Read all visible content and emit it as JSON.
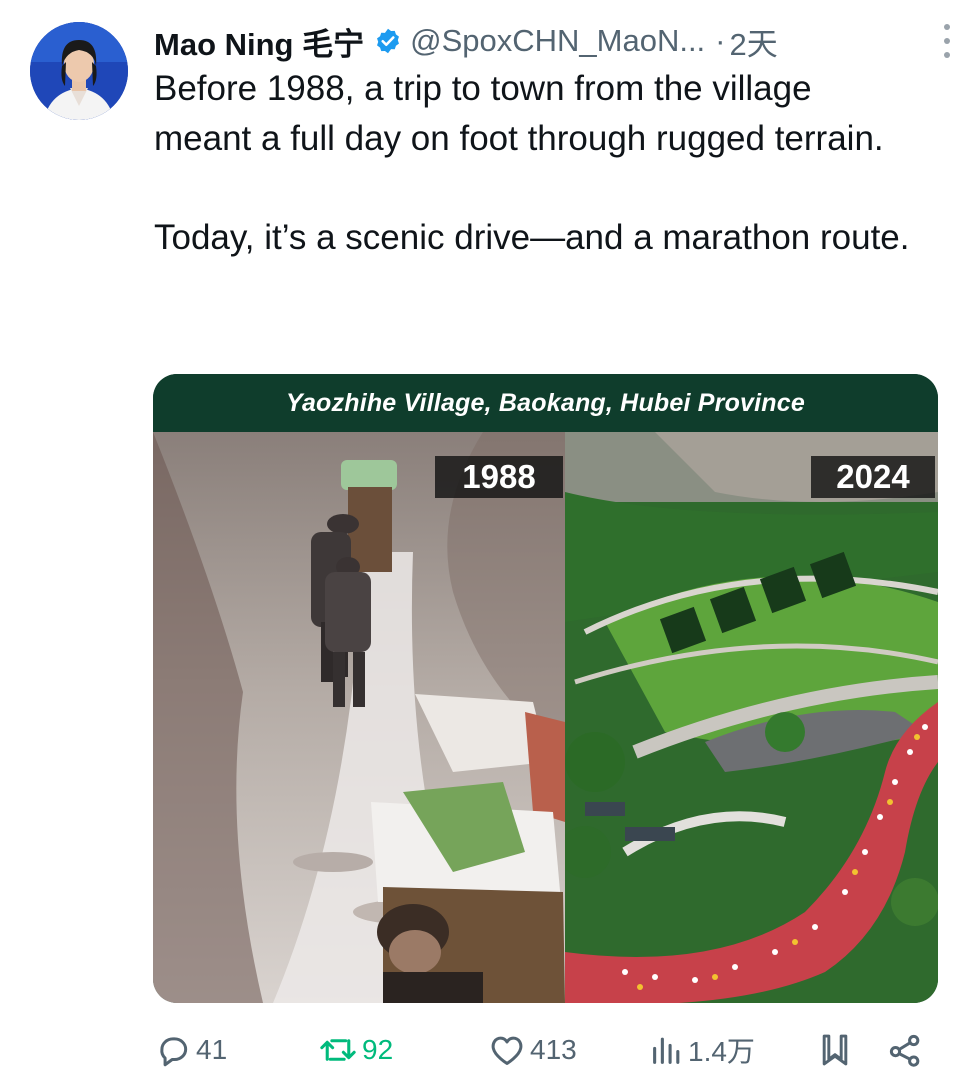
{
  "tweet": {
    "author_name": "Mao Ning 毛宁",
    "handle": "@SpoxCHN_MaoN...",
    "separator": "·",
    "time": "2天",
    "paragraphs": [
      "Before 1988, a trip to town from the village meant a full day on foot through rugged terrain.",
      "Today, it’s a scenic drive—and a marathon route."
    ]
  },
  "media": {
    "banner_title": "Yaozhihe Village, Baokang, Hubei Province",
    "left_year": "1988",
    "right_year": "2024"
  },
  "actions": {
    "reply_count": "41",
    "retweet_count": "92",
    "like_count": "413",
    "view_count": "1.4万"
  },
  "icons": {
    "verified": "verified-badge-icon",
    "more": "more-options-icon",
    "reply": "reply-icon",
    "retweet": "retweet-icon",
    "like": "heart-icon",
    "views": "views-chart-icon",
    "bookmark": "bookmark-icon",
    "share": "share-icon"
  },
  "colors": {
    "verified_blue": "#1d9bf0",
    "retweet_green": "#00ba7c",
    "secondary_text": "#536471",
    "banner_bg": "#0f3d2c"
  }
}
